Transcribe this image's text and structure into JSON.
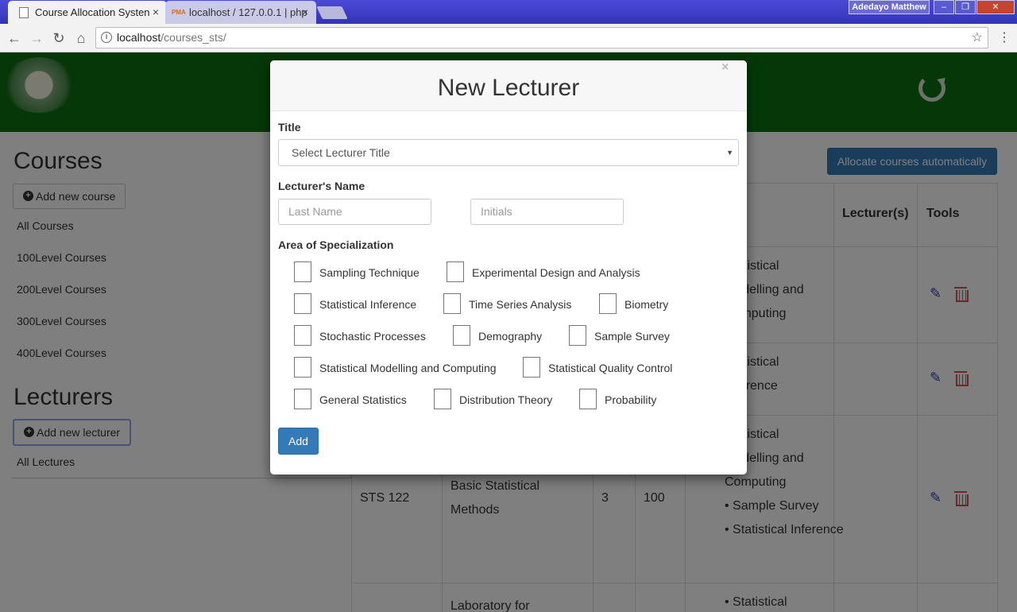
{
  "browser": {
    "tabs": [
      {
        "title": "Course Allocation Systen",
        "close": "×"
      },
      {
        "title": "localhost / 127.0.0.1 | php",
        "close": "×",
        "favicon": "PMA"
      }
    ],
    "user": "Adedayo Matthew",
    "window_controls": {
      "minimize": "–",
      "maximize": "❐",
      "close": "✕"
    },
    "url": {
      "host": "localhost",
      "path": "/courses_sts/"
    }
  },
  "sidebar": {
    "courses_heading": "Courses",
    "add_course": "Add new course",
    "course_links": [
      "All Courses",
      "100Level Courses",
      "200Level Courses",
      "300Level Courses",
      "400Level Courses"
    ],
    "lecturers_heading": "Lecturers",
    "add_lecturer": "Add new lecturer",
    "lecturer_links": [
      "All Lectures"
    ]
  },
  "main": {
    "allocate_button": "Allocate courses automatically",
    "table_headers": {
      "lecturers": "Lecturer(s)",
      "tools": "Tools"
    },
    "rows": [
      {
        "spec_lines": [
          "Statistical",
          "Modelling and",
          "Computing"
        ]
      },
      {
        "spec_lines": [
          "Statistical",
          "Inference"
        ]
      },
      {
        "code": "STS 122",
        "title_lines": [
          "Basic Statistical",
          "Methods"
        ],
        "units": "3",
        "level": "100",
        "spec_lines": [
          "Statistical",
          "Modelling and",
          "Computing"
        ],
        "bullets": [
          "Sample Survey",
          "Statistical Inference"
        ]
      },
      {
        "title_lines": [
          "Laboratory for"
        ],
        "bullets": [
          "Statistical"
        ]
      }
    ]
  },
  "modal": {
    "title": "New Lecturer",
    "close": "×",
    "title_label": "Title",
    "title_select": "Select Lecturer Title",
    "name_label": "Lecturer's Name",
    "last_name_placeholder": "Last Name",
    "initials_placeholder": "Initials",
    "area_label": "Area of Specialization",
    "specializations": [
      "Sampling Technique",
      "Experimental Design and Analysis",
      "Statistical Inference",
      "Time Series Analysis",
      "Biometry",
      "Stochastic Processes",
      "Demography",
      "Sample Survey",
      "Statistical Modelling and Computing",
      "Statistical Quality Control",
      "General Statistics",
      "Distribution Theory",
      "Probability"
    ],
    "add_button": "Add"
  },
  "colors": {
    "header_green": "#0c6e10",
    "primary_blue": "#337ab7",
    "danger_red": "#d9534f"
  }
}
